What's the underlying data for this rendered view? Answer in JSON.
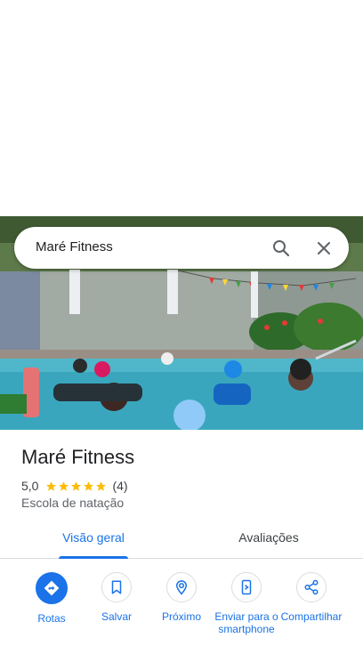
{
  "search": {
    "query": "Maré Fitness",
    "search_icon": "search-icon",
    "close_icon": "close-icon"
  },
  "place": {
    "name": "Maré Fitness",
    "rating_value": "5,0",
    "rating_stars": 5,
    "review_count": "(4)",
    "category": "Escola de natação"
  },
  "tabs": [
    {
      "label": "Visão geral",
      "active": true
    },
    {
      "label": "Avaliações",
      "active": false
    }
  ],
  "actions": [
    {
      "label": "Rotas",
      "icon": "directions-icon"
    },
    {
      "label": "Salvar",
      "icon": "bookmark-icon"
    },
    {
      "label": "Próximo",
      "icon": "nearby-icon"
    },
    {
      "label": "Enviar para o smartphone",
      "icon": "send-to-phone-icon"
    },
    {
      "label": "Compartilhar",
      "icon": "share-icon"
    }
  ],
  "colors": {
    "accent": "#1a73e8",
    "star": "#fbbc04",
    "pool": "#4fb7c9"
  }
}
